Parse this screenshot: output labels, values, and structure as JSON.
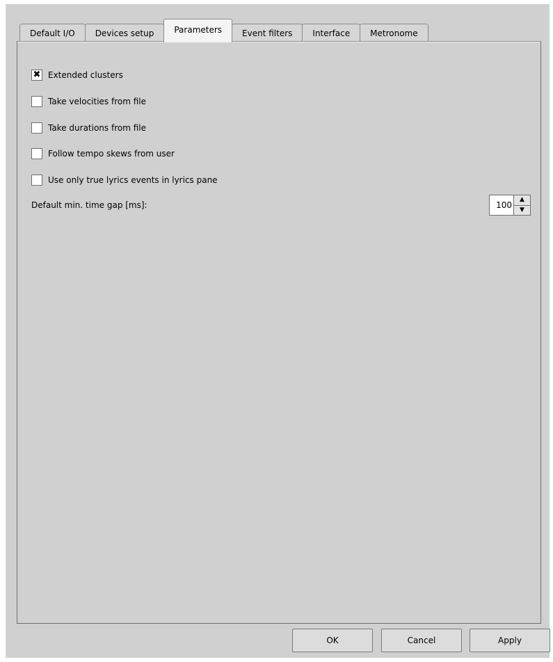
{
  "tabs": [
    {
      "label": "Default I/O",
      "active": false
    },
    {
      "label": "Devices setup",
      "active": false
    },
    {
      "label": "Parameters",
      "active": true
    },
    {
      "label": "Event filters",
      "active": false
    },
    {
      "label": "Interface",
      "active": false
    },
    {
      "label": "Metronome",
      "active": false
    }
  ],
  "options": [
    {
      "label": "Extended clusters",
      "checked": true
    },
    {
      "label": "Take velocities from file",
      "checked": false
    },
    {
      "label": "Take durations from file",
      "checked": false
    },
    {
      "label": "Follow tempo skews from user",
      "checked": false
    },
    {
      "label": "Use only true lyrics events in lyrics pane",
      "checked": false
    }
  ],
  "timegap": {
    "label": "Default min. time gap [ms]:",
    "value": "100"
  },
  "buttons": {
    "ok": "OK",
    "cancel": "Cancel",
    "apply": "Apply"
  },
  "icons": {
    "check_mark": "✖",
    "spin_up": "▲",
    "spin_down": "▼"
  }
}
